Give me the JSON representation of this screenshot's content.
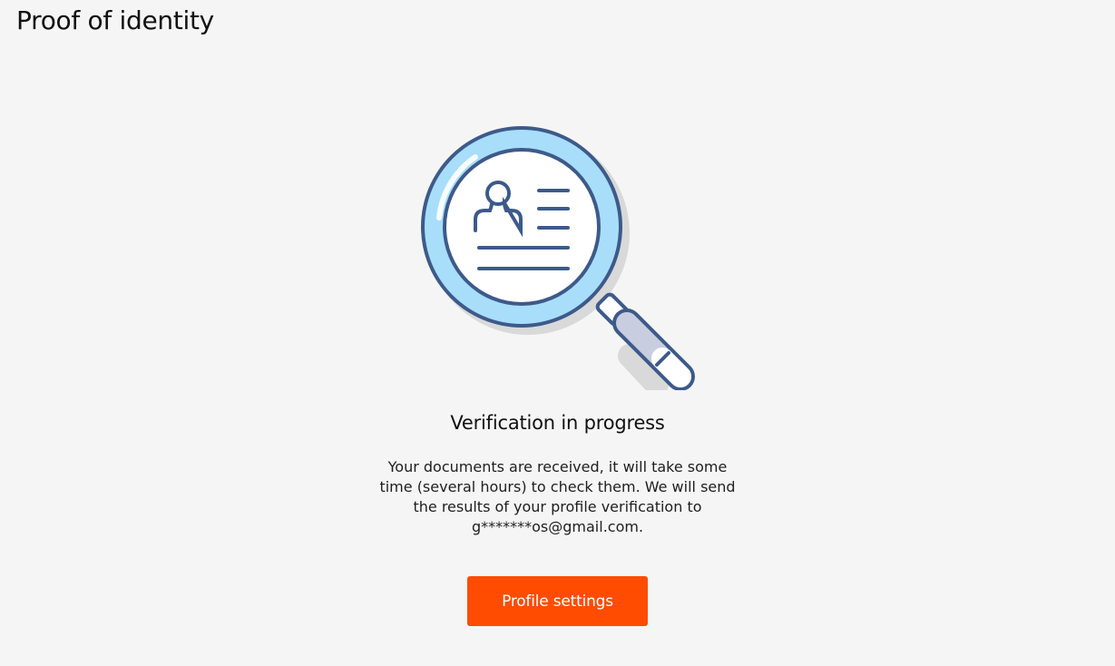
{
  "header": {
    "title": "Proof of identity"
  },
  "illustration": {
    "icon": "magnifying-glass-profile-icon",
    "colors": {
      "outline": "#3d5a8a",
      "lens_ring": "#a8defa",
      "lens_fill": "#ffffff",
      "handle_grip": "#c8cde0",
      "shadow": "#d9d9d9"
    }
  },
  "status": {
    "title": "Verification in progress",
    "message": "Your documents are received, it will take some time (several hours) to check them. We will send the results of your profile verification to g*******os@gmail.com."
  },
  "actions": {
    "profile_settings_label": "Profile settings",
    "button_color": "#ff4c00"
  }
}
